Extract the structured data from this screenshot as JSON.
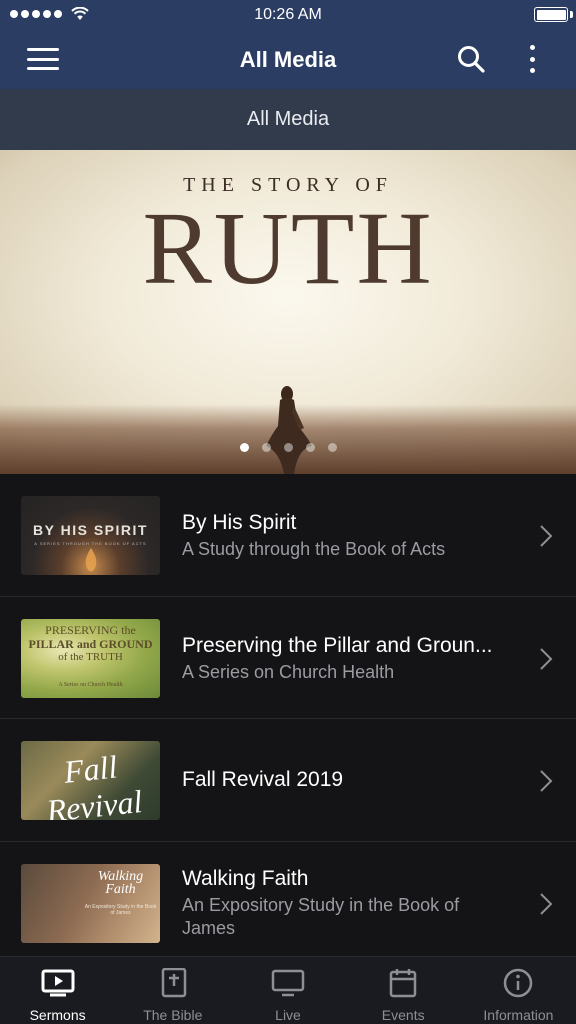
{
  "status_bar": {
    "time": "10:26 AM",
    "signal_dots": 5,
    "wifi_icon": "wifi-icon",
    "battery_icon": "battery-icon"
  },
  "nav": {
    "title": "All Media",
    "menu_icon": "hamburger-menu-icon",
    "search_icon": "search-icon",
    "more_icon": "vertical-ellipsis-icon"
  },
  "section": {
    "title": "All Media"
  },
  "hero": {
    "subtitle": "THE STORY OF",
    "title": "RUTH",
    "page_count": 5,
    "active_page": 0
  },
  "media_items": [
    {
      "title": "By His Spirit",
      "subtitle": "A Study through the Book of Acts",
      "thumb_title": "BY HIS SPIRIT",
      "thumb_subtitle": "A SERIES THROUGH THE BOOK OF ACTS"
    },
    {
      "title": "Preserving the Pillar and Groun...",
      "subtitle": "A Series on Church Health",
      "thumb_line1": "PRESERVING the",
      "thumb_line2": "PILLAR and GROUND",
      "thumb_line3": "of the TRUTH",
      "thumb_footer": "A Series on Church Health"
    },
    {
      "title": "Fall Revival 2019",
      "subtitle": "",
      "thumb_title": "Fall Revival"
    },
    {
      "title": "Walking Faith",
      "subtitle": "An Expository Study in the Book of James",
      "thumb_title": "Walking Faith",
      "thumb_subtitle": "An Expository Study in the Book of James"
    }
  ],
  "tabs": [
    {
      "label": "Sermons",
      "icon": "video-player-icon",
      "active": true
    },
    {
      "label": "The Bible",
      "icon": "bible-book-icon",
      "active": false
    },
    {
      "label": "Live",
      "icon": "monitor-icon",
      "active": false
    },
    {
      "label": "Events",
      "icon": "calendar-icon",
      "active": false
    },
    {
      "label": "Information",
      "icon": "info-circle-icon",
      "active": false
    }
  ],
  "colors": {
    "nav_background": "#2b3d63",
    "section_background": "#323b4c",
    "list_background": "#141416",
    "tab_bar_background": "#1a1b20",
    "subtitle_gray": "#9a9ca2"
  }
}
